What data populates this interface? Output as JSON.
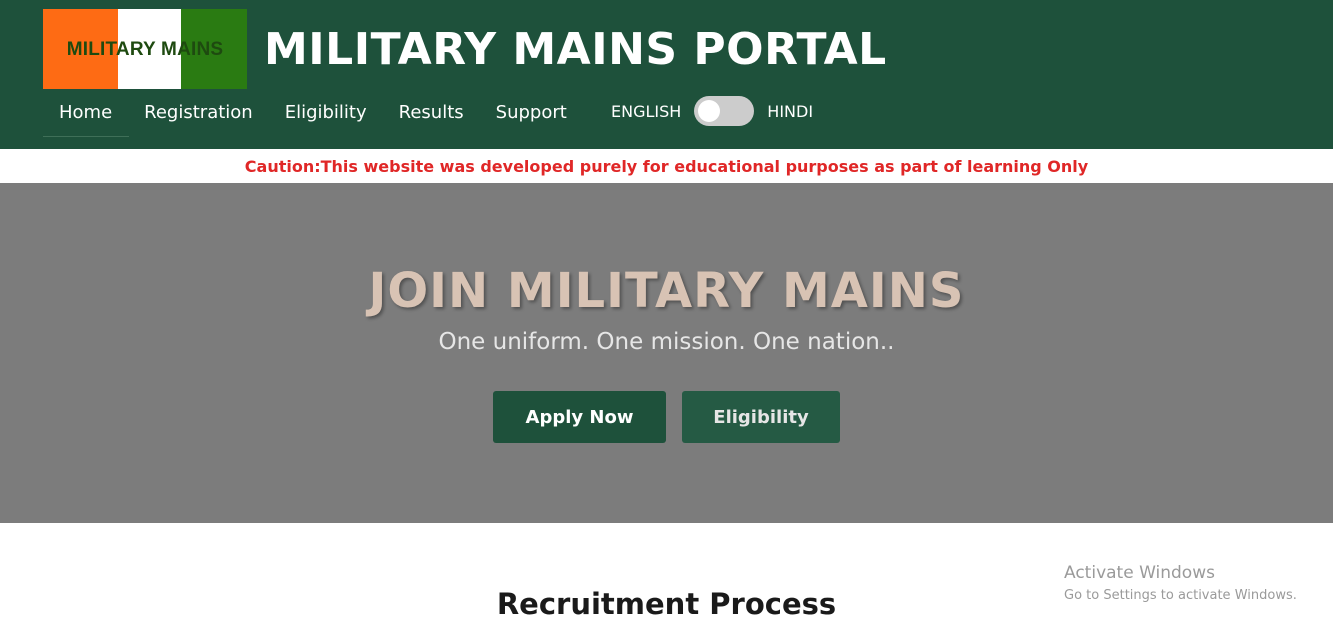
{
  "header": {
    "logo_text": "MILITARY MAINS",
    "title": "MILITARY MAINS PORTAL",
    "nav": [
      {
        "label": "Home"
      },
      {
        "label": "Registration"
      },
      {
        "label": "Eligibility"
      },
      {
        "label": "Results"
      },
      {
        "label": "Support"
      }
    ],
    "language": {
      "left_label": "ENGLISH",
      "right_label": "HINDI",
      "selected": "ENGLISH"
    },
    "colors": {
      "header_bg": "#1e513b",
      "logo_orange": "#fe6b14",
      "logo_white": "#ffffff",
      "logo_green": "#2a7b12"
    }
  },
  "caution": {
    "text": "Caution:This website was developed purely for educational purposes as part of learning Only",
    "color": "#e02727"
  },
  "hero": {
    "title": "JOIN MILITARY MAINS",
    "subtitle": "One uniform. One mission. One nation..",
    "primary_button": "Apply Now",
    "secondary_button": "Eligibility"
  },
  "main": {
    "section_title": "Recruitment Process"
  },
  "watermark": {
    "line1": "Activate Windows",
    "line2": "Go to Settings to activate Windows."
  }
}
